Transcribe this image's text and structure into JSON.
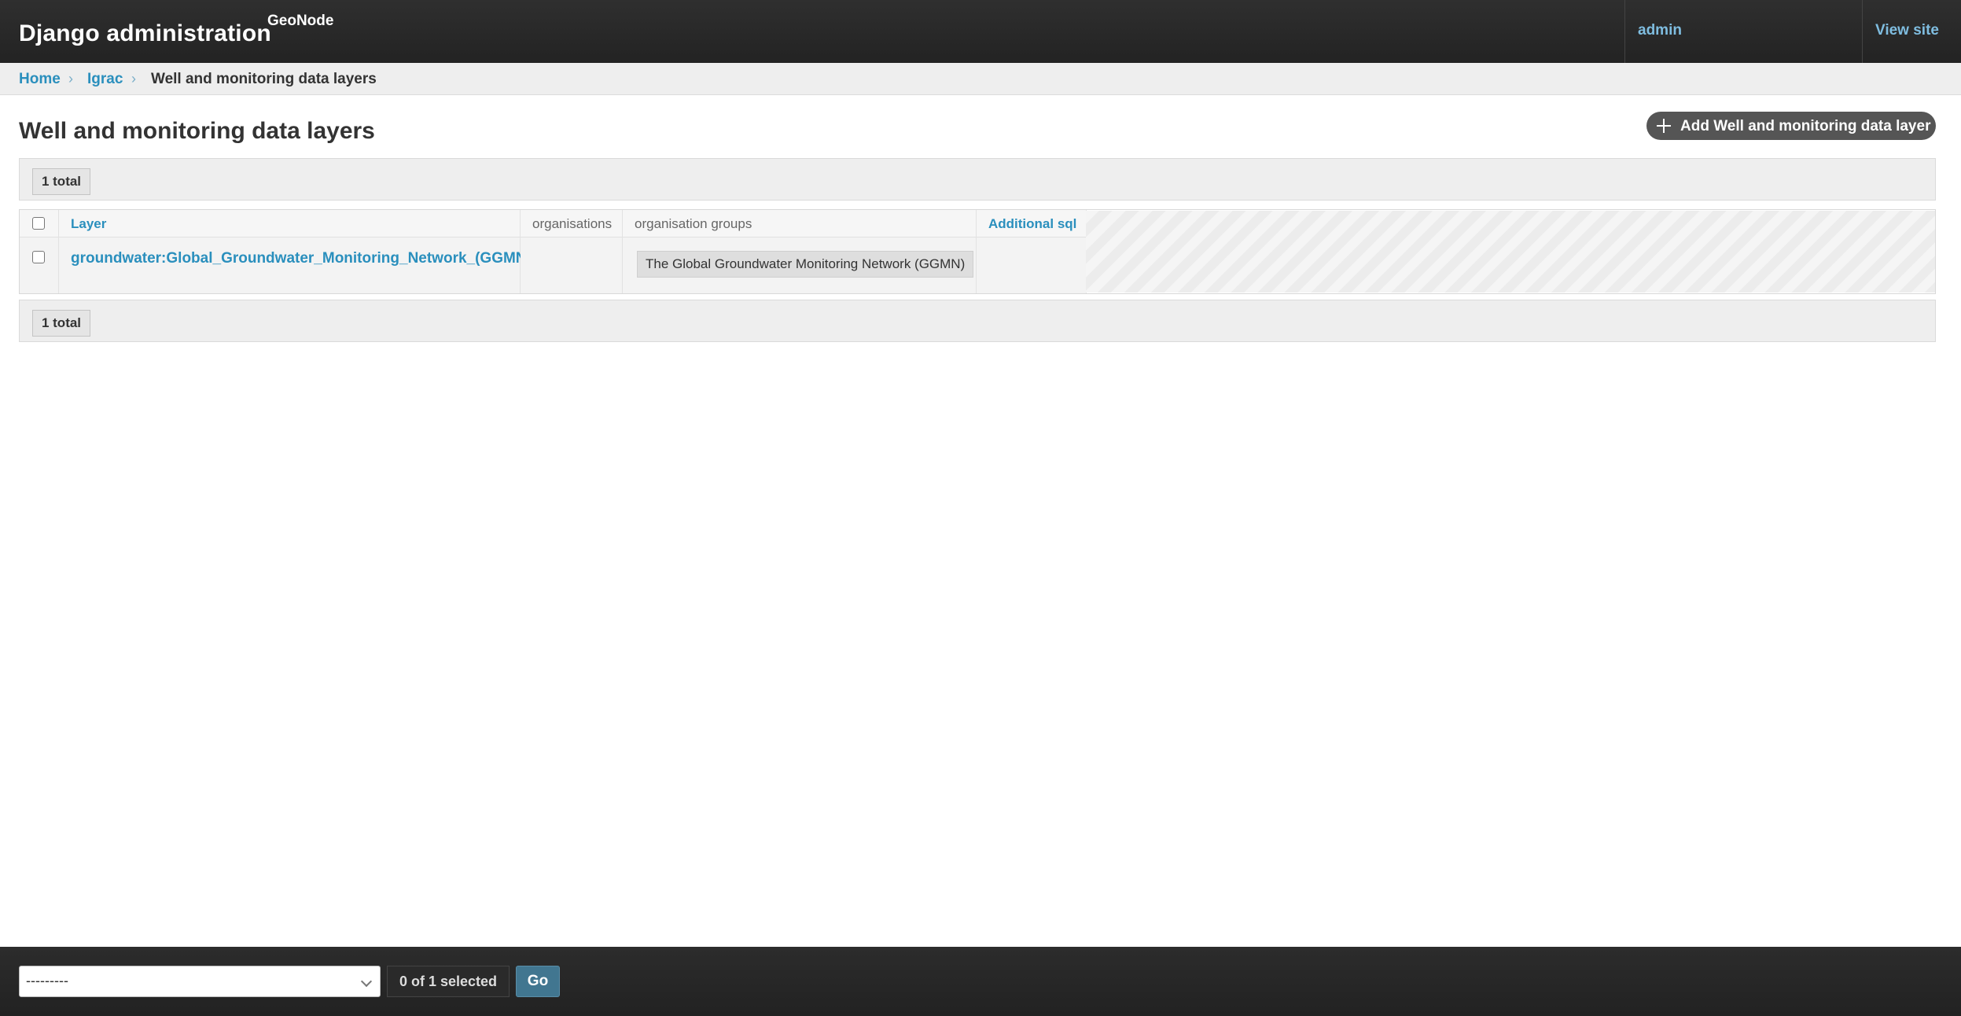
{
  "header": {
    "site_name": "Django administration",
    "brand_sub": "GeoNode",
    "user_link": "admin",
    "view_site_link": "View site"
  },
  "breadcrumbs": {
    "items": [
      "Home",
      "Igrac",
      "Well and monitoring data layers"
    ],
    "separator": "›"
  },
  "main": {
    "title": "Well and monitoring data layers",
    "add_button_label": "Add Well and monitoring data layer",
    "paginator_total": "1 total"
  },
  "table": {
    "columns": [
      "Layer",
      "organisations",
      "organisation groups",
      "Additional sql"
    ],
    "rows": [
      {
        "layer": "groundwater:Global_Groundwater_Monitoring_Network_(GGMN)",
        "organisations": "",
        "organisation_groups": "The Global Groundwater Monitoring Network (GGMN)",
        "additional_sql": ""
      }
    ]
  },
  "actions": {
    "select_value": "---------",
    "selection_counter": "0 of 1 selected",
    "go_label": "Go"
  },
  "colors": {
    "header_bg": "#2b2b2b",
    "link": "#2a8fbd",
    "go_button": "#417690"
  }
}
